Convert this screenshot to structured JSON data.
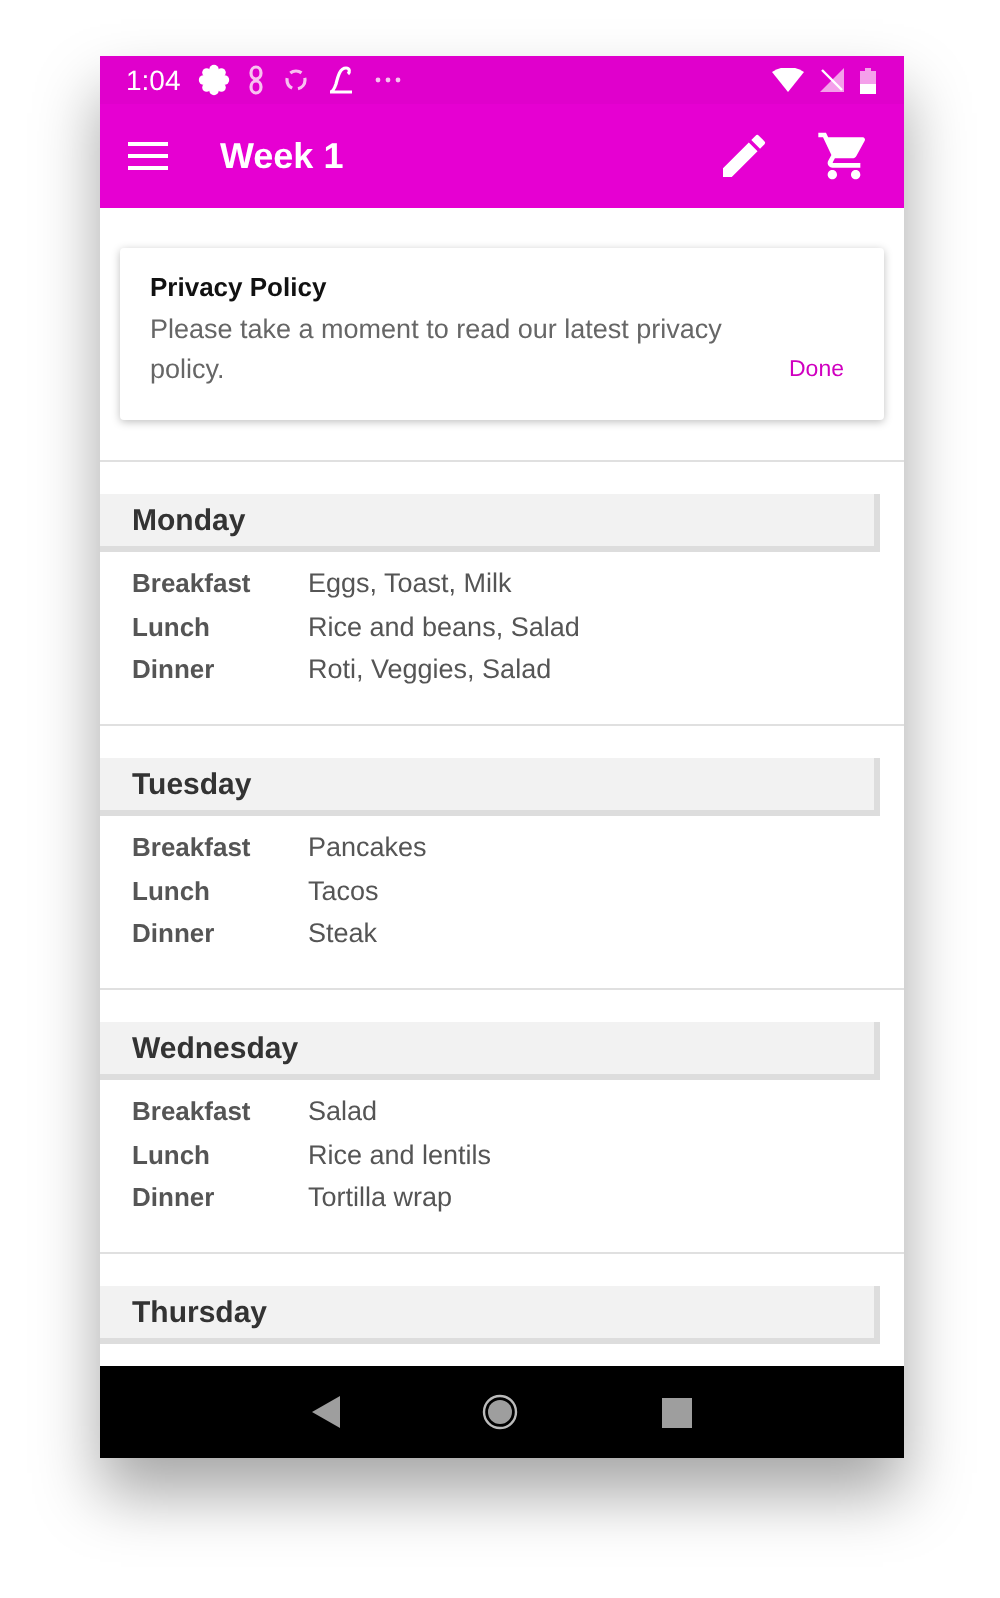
{
  "status_bar": {
    "time": "1:04"
  },
  "app_bar": {
    "title": "Week 1"
  },
  "notice": {
    "title": "Privacy Policy",
    "message": "Please take a moment to read our latest privacy policy.",
    "action": "Done"
  },
  "days": [
    {
      "name": "Monday",
      "meals": [
        {
          "label": "Breakfast",
          "value": "Eggs, Toast, Milk"
        },
        {
          "label": "Lunch",
          "value": "Rice and beans, Salad"
        },
        {
          "label": "Dinner",
          "value": "Roti, Veggies, Salad"
        }
      ]
    },
    {
      "name": "Tuesday",
      "meals": [
        {
          "label": "Breakfast",
          "value": "Pancakes"
        },
        {
          "label": "Lunch",
          "value": "Tacos"
        },
        {
          "label": "Dinner",
          "value": "Steak"
        }
      ]
    },
    {
      "name": "Wednesday",
      "meals": [
        {
          "label": "Breakfast",
          "value": "Salad"
        },
        {
          "label": "Lunch",
          "value": "Rice and lentils"
        },
        {
          "label": "Dinner",
          "value": "Tortilla wrap"
        }
      ]
    },
    {
      "name": "Thursday"
    }
  ]
}
